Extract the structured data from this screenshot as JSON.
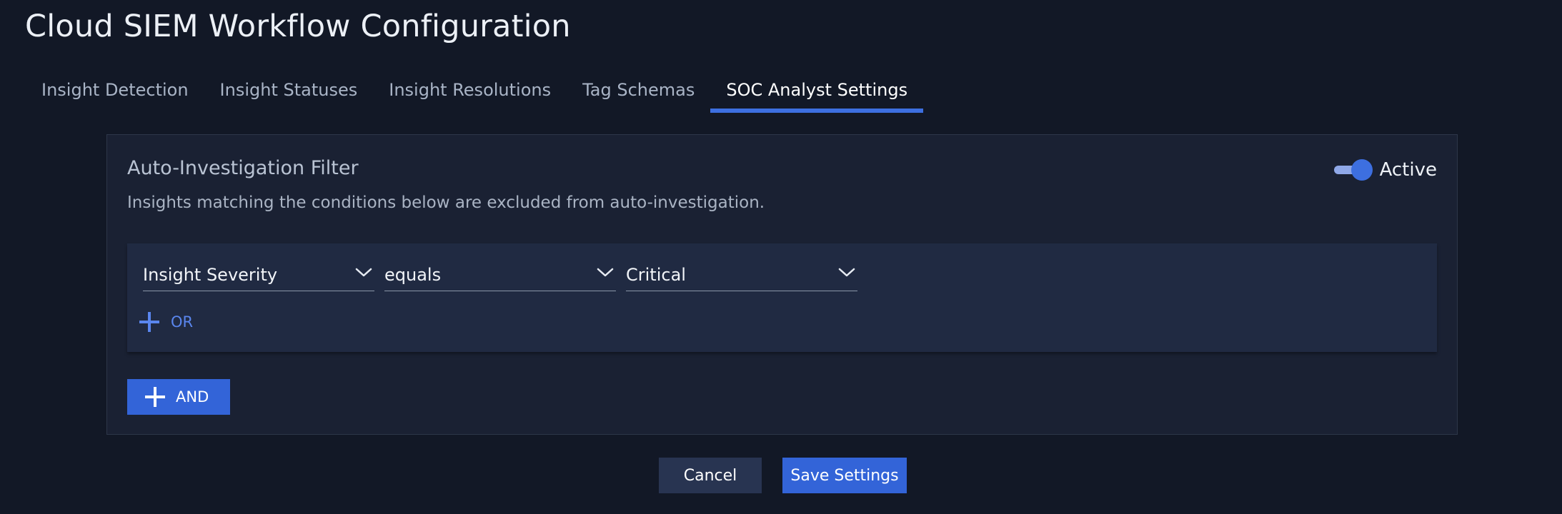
{
  "page": {
    "title": "Cloud SIEM Workflow Configuration"
  },
  "tabs": [
    {
      "label": "Insight Detection",
      "active": false
    },
    {
      "label": "Insight Statuses",
      "active": false
    },
    {
      "label": "Insight Resolutions",
      "active": false
    },
    {
      "label": "Tag Schemas",
      "active": false
    },
    {
      "label": "SOC Analyst Settings",
      "active": true
    }
  ],
  "filter": {
    "title": "Auto-Investigation Filter",
    "description": "Insights matching the conditions below are excluded from auto-investigation.",
    "toggle": {
      "label": "Active",
      "on": true
    },
    "condition": {
      "field": "Insight Severity",
      "operator": "equals",
      "value": "Critical"
    },
    "or_label": "OR",
    "and_label": "AND"
  },
  "footer": {
    "cancel_label": "Cancel",
    "save_label": "Save Settings"
  },
  "icons": {
    "dropdown": "chevron-down-icon",
    "add": "plus-icon"
  },
  "colors": {
    "background": "#121826",
    "card": "#1a2133",
    "condition_panel": "#202a42",
    "accent": "#3d6fe0",
    "link": "#5a86ee",
    "cancel_button": "#283451"
  }
}
